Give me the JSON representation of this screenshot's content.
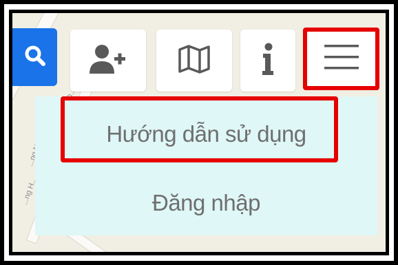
{
  "toolbar": {
    "search_icon": "search-icon",
    "add_user_icon": "add-user-icon",
    "map_icon": "map-icon",
    "info_icon": "info-icon",
    "menu_icon": "hamburger-menu-icon"
  },
  "map": {
    "street_labels": [
      "...ng H...",
      "...ng Ngô...",
      "...Nguyễn Đ..."
    ]
  },
  "menu": {
    "items": [
      {
        "label": "Hướng dẫn sử dụng"
      },
      {
        "label": "Đăng nhập"
      }
    ]
  },
  "colors": {
    "highlight": "#e60000",
    "search_button": "#1a73e8",
    "menu_background": "#dff7f6",
    "menu_text": "#6f6f6f"
  }
}
